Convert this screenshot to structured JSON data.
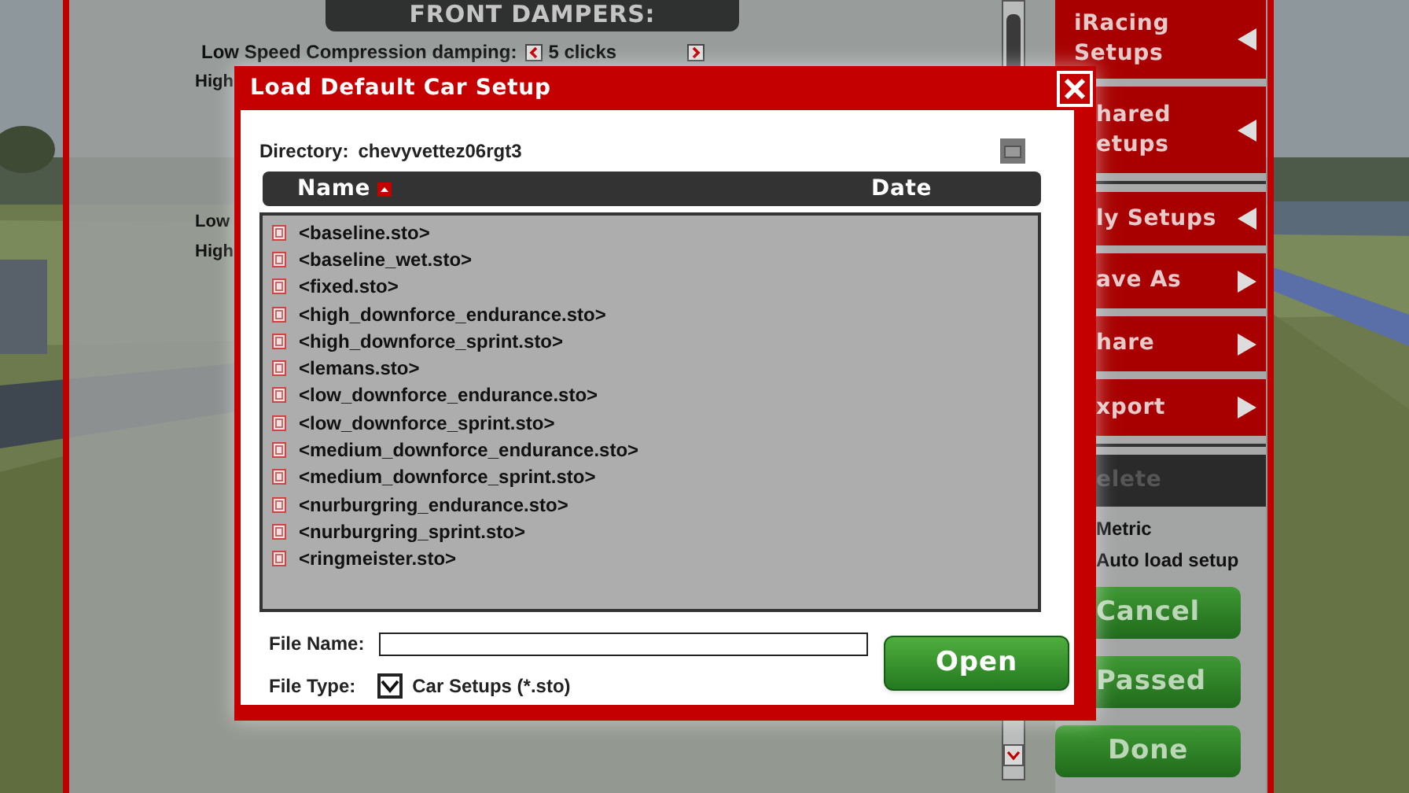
{
  "settings_panel": {
    "section_title": "FRONT DAMPERS:",
    "rows": [
      {
        "label": "Low Speed Compression damping:",
        "value": "5 clicks"
      },
      {
        "label": "High"
      },
      {
        "label": "Low"
      },
      {
        "label": "High"
      }
    ]
  },
  "setup_menu": [
    {
      "lines": [
        "iRacing",
        "Setups"
      ],
      "kind": "back",
      "disabled": false
    },
    {
      "lines": [
        "hared",
        "etups"
      ],
      "kind": "back",
      "disabled": false
    },
    {
      "lines": [
        "ly Setups"
      ],
      "kind": "back",
      "disabled": false
    },
    {
      "lines": [
        "ave As"
      ],
      "kind": "forward",
      "disabled": false
    },
    {
      "lines": [
        "hare"
      ],
      "kind": "forward",
      "disabled": false
    },
    {
      "lines": [
        "xport"
      ],
      "kind": "forward",
      "disabled": false
    },
    {
      "lines": [
        "elete"
      ],
      "kind": "plain",
      "disabled": true
    }
  ],
  "options": [
    "Metric",
    "Auto load setup"
  ],
  "action_buttons": [
    "Cancel",
    "Passed",
    "Done"
  ],
  "dialog": {
    "title": "Load Default Car Setup",
    "directory_label": "Directory:",
    "directory": "chevyvettez06rgt3",
    "columns": [
      {
        "label": "Name",
        "sorted": true
      },
      {
        "label": "Date",
        "sorted": false
      }
    ],
    "files": [
      "<baseline.sto>",
      "<baseline_wet.sto>",
      "<fixed.sto>",
      "<high_downforce_endurance.sto>",
      "<high_downforce_sprint.sto>",
      "<lemans.sto>",
      "<low_downforce_endurance.sto>",
      "<low_downforce_sprint.sto>",
      "<medium_downforce_endurance.sto>",
      "<medium_downforce_sprint.sto>",
      "<nurburgring_endurance.sto>",
      "<nurburgring_sprint.sto>",
      "<ringmeister.sto>"
    ],
    "file_name_label": "File Name:",
    "file_type": {
      "label": "File Type:",
      "checked": true,
      "option": "Car Setups (*.sto)"
    },
    "open_button": "Open"
  }
}
